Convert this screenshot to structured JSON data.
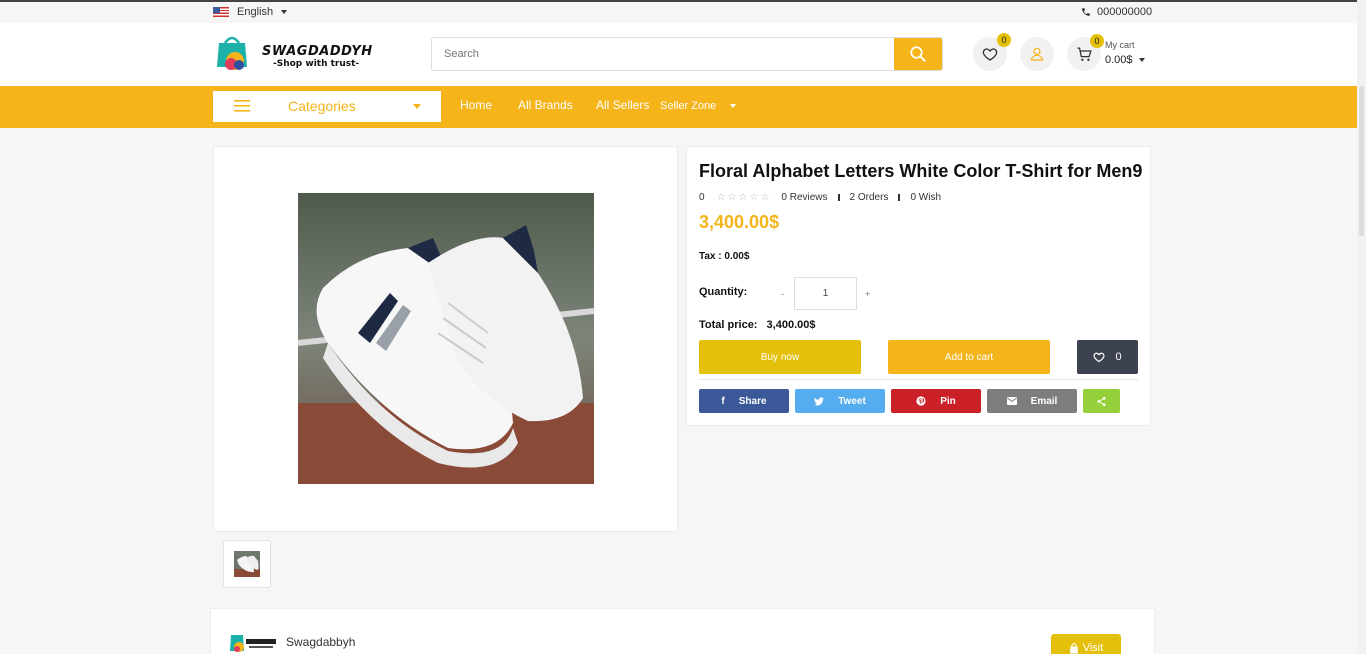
{
  "topbar": {
    "language": "English",
    "phone": "000000000"
  },
  "header": {
    "logo": {
      "name": "SWAGDADDYH",
      "tagline": "-Shop with trust-"
    },
    "search_placeholder": "Search",
    "wishlist_count": "0",
    "cart": {
      "count": "0",
      "label": "My cart",
      "total": "0.00$"
    }
  },
  "nav": {
    "categories_label": "Categories",
    "links": [
      "Home",
      "All Brands",
      "All Sellers",
      "Seller Zone"
    ]
  },
  "product": {
    "title": "Floral Alphabet Letters White Color T-Shirt for Men9",
    "rating": "0",
    "stars_filled": 0,
    "reviews": "0 Reviews",
    "orders": "2 Orders",
    "wish": "0 Wish",
    "price": "3,400.00$",
    "tax": "Tax : 0.00$",
    "quantity_label": "Quantity:",
    "quantity_minus": "-",
    "quantity_value": "1",
    "quantity_plus": "+",
    "total_label": "Total price:",
    "total_value": "3,400.00$",
    "buy_now": "Buy now",
    "add_to_cart": "Add to cart",
    "wishlist_count": "0"
  },
  "share": {
    "facebook": "Share",
    "twitter": "Tweet",
    "pinterest": "Pin",
    "email": "Email"
  },
  "seller": {
    "name": "Swagdabbyh",
    "visit": "Visit"
  },
  "colors": {
    "accent": "#f4b41a",
    "buy_now": "#e4c00a",
    "wishlist_btn": "#3d4250",
    "facebook": "#3b5998",
    "twitter": "#55acee",
    "pinterest": "#cb2027",
    "email": "#7d7d7d",
    "sharethis": "#95d03a"
  }
}
